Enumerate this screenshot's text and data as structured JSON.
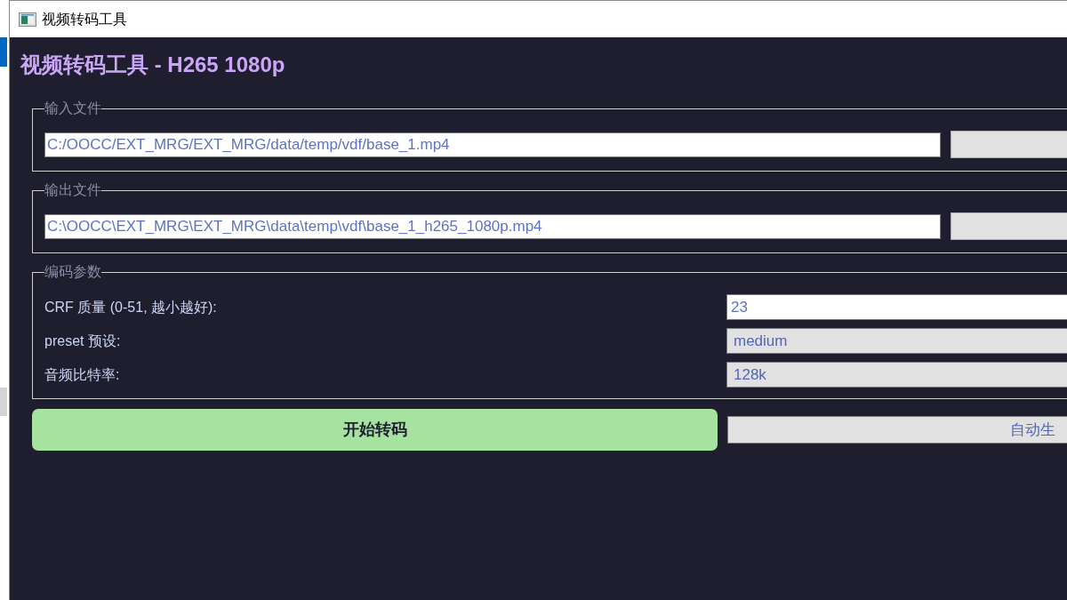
{
  "window": {
    "title": "视频转码工具"
  },
  "heading": "视频转码工具 - H265 1080p",
  "file_groups": [
    {
      "legend": "输入文件",
      "path": {
        "value": "C:/OOCC/EXT_MRG/EXT_MRG/data/temp/vdf/base_1.mp4"
      }
    },
    {
      "legend": "输出文件",
      "path": {
        "value": "C:\\OOCC\\EXT_MRG\\EXT_MRG\\data\\temp\\vdf\\base_1_h265_1080p.mp4"
      }
    }
  ],
  "encoding": {
    "legend": "编码参数",
    "params": [
      {
        "label": "CRF 质量 (0-51, 越小越好):",
        "kind": "spinbox",
        "value": "23"
      },
      {
        "label": "preset 预设:",
        "kind": "combobox",
        "value": "medium"
      },
      {
        "label": "音频比特率:",
        "kind": "combobox",
        "value": "128k"
      }
    ]
  },
  "start_button": {
    "label": "开始转码"
  },
  "output_field": {
    "placeholder": "自动生"
  }
}
